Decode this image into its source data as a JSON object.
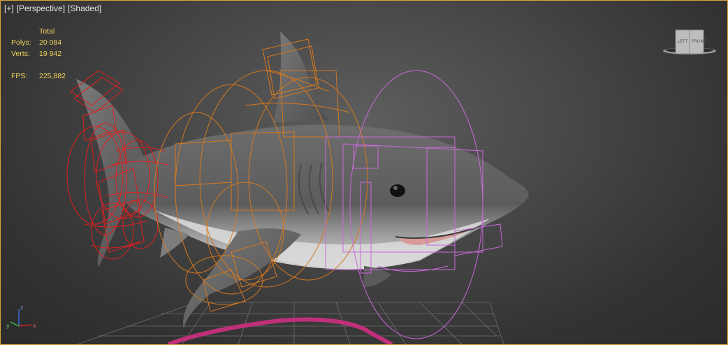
{
  "viewport": {
    "label_parts": [
      "[+]",
      "[Perspective]",
      "[Shaded]"
    ]
  },
  "stats": {
    "header": "Total",
    "polys_label": "Polys:",
    "polys_value": "20 084",
    "verts_label": "Verts:",
    "verts_value": "19 942",
    "fps_label": "FPS:",
    "fps_value": "225,882"
  },
  "viewcube": {
    "face_left": "LEFT",
    "face_front": "FRONT"
  },
  "axis": {
    "x": "x",
    "y": "y",
    "z": "z"
  },
  "colors": {
    "frame": "#d8a53a",
    "stats_text": "#f0d35a",
    "rig_red": "#e01e1e",
    "rig_orange": "#d6781e",
    "rig_magenta": "#c86ad8",
    "ground_path": "#c0307a"
  },
  "icons": [
    "viewcube-icon",
    "axis-tripod-icon"
  ]
}
